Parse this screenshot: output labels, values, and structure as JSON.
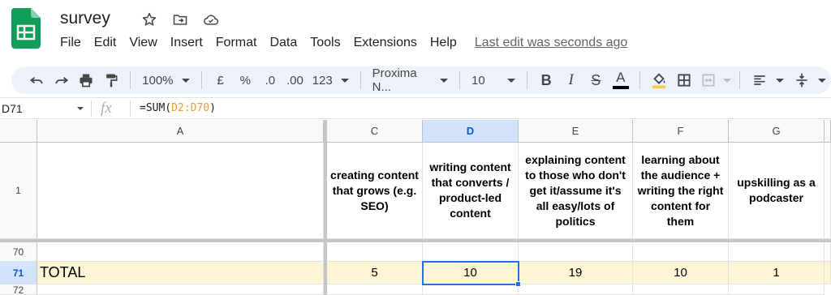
{
  "app": {
    "doc_title": "survey",
    "menu": [
      "File",
      "Edit",
      "View",
      "Insert",
      "Format",
      "Data",
      "Tools",
      "Extensions",
      "Help"
    ],
    "last_edit": "Last edit was seconds ago",
    "brand_color": "#0f9d58"
  },
  "toolbar": {
    "zoom": "100%",
    "currency": "£",
    "percent": "%",
    "decrease_decimal": ".0",
    "increase_decimal": ".00",
    "more_formats": "123",
    "font": "Proxima N...",
    "font_size": "10",
    "bold": "B",
    "italic": "I",
    "strikethrough": "S",
    "text_color": "A",
    "icons": [
      "undo-icon",
      "redo-icon",
      "print-icon",
      "paint-format-icon",
      "fill-color-icon",
      "borders-icon",
      "merge-cells-icon",
      "align-left-icon",
      "vertical-align-icon"
    ]
  },
  "formula_bar": {
    "name_box": "D71",
    "fx": "fx",
    "formula_prefix": "=SUM(",
    "formula_ref": "D2:D70",
    "formula_suffix": ")"
  },
  "grid": {
    "columns": [
      {
        "letter": "A",
        "selected": false
      },
      {
        "letter": "C",
        "selected": false
      },
      {
        "letter": "D",
        "selected": true
      },
      {
        "letter": "E",
        "selected": false
      },
      {
        "letter": "F",
        "selected": false
      },
      {
        "letter": "G",
        "selected": false
      }
    ],
    "rows": [
      "1",
      "70",
      "71",
      "72"
    ],
    "header_row": {
      "A": "",
      "C": "creating content that grows (e.g. SEO)",
      "D": "writing content that converts  / product-led content",
      "E": "explaining content to those who don't get it/assume it's all easy/lots of politics",
      "F": "learning about the audience + writing the right content for them",
      "G": "upskilling as a podcaster"
    },
    "total_row": {
      "A": "TOTAL",
      "C": "5",
      "D": "10",
      "E": "19",
      "F": "10",
      "G": "1"
    },
    "selected_cell": "D71",
    "total_row_color": "#fef5d4",
    "selection_color": "#1a73e8"
  }
}
